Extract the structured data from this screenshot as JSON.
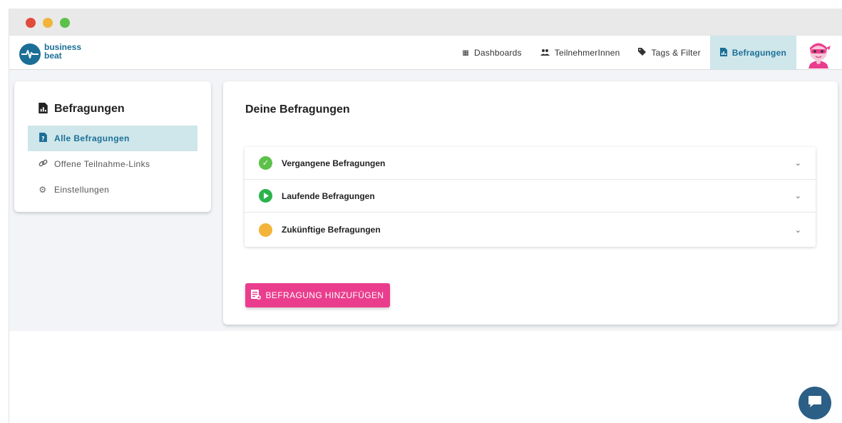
{
  "window": {
    "controls": [
      "close",
      "minimize",
      "maximize"
    ]
  },
  "logo": {
    "line1": "business",
    "line2": "beat",
    "color": "#1b6f97"
  },
  "nav": {
    "items": [
      {
        "label": "Dashboards",
        "icon": "grid-icon",
        "active": false
      },
      {
        "label": "TeilnehmerInnen",
        "icon": "users-icon",
        "active": false
      },
      {
        "label": "Tags & Filter",
        "icon": "tag-icon",
        "active": false
      },
      {
        "label": "Befragungen",
        "icon": "survey-icon",
        "active": true
      }
    ],
    "active_color": "#cfe6ea"
  },
  "sidebar": {
    "title": "Befragungen",
    "title_icon": "survey-icon",
    "items": [
      {
        "label": "Alle Befragungen",
        "icon": "survey-file-icon",
        "active": true
      },
      {
        "label": "Offene Teilnahme-Links",
        "icon": "link-icon",
        "active": false
      },
      {
        "label": "Einstellungen",
        "icon": "gear-icon",
        "active": false
      }
    ]
  },
  "main": {
    "title": "Deine Befragungen",
    "sections": [
      {
        "label": "Vergangene Befragungen",
        "icon": "check-circle-icon",
        "color": "#5cc14a"
      },
      {
        "label": "Laufende Befragungen",
        "icon": "play-circle-icon",
        "color": "#2bb34a"
      },
      {
        "label": "Zukünftige Befragungen",
        "icon": "pending-circle-icon",
        "color": "#f2b43a"
      }
    ],
    "add_button_label": "BEFRAGUNG HINZUFÜGEN",
    "add_button_color": "#ea3d8d"
  },
  "chat": {
    "icon": "chat-icon",
    "color": "#2c5f86"
  }
}
